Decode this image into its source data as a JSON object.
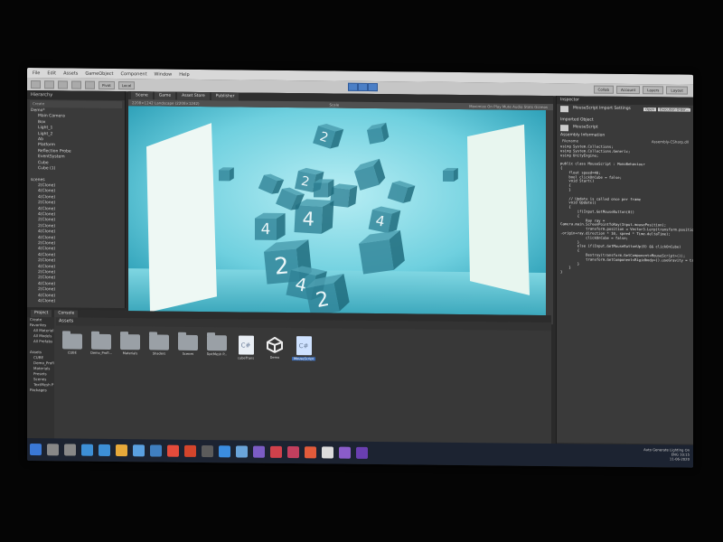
{
  "menubar": {
    "items": [
      "File",
      "Edit",
      "Assets",
      "GameObject",
      "Component",
      "Window",
      "Help"
    ]
  },
  "toolbar": {
    "pivot": "Pivot",
    "local": "Local",
    "right": [
      "Collab",
      "Account",
      "Layers",
      "Layout"
    ]
  },
  "hierarchy": {
    "tab": "Hierarchy",
    "create": "Create",
    "items": [
      "Demo*",
      "Main Camera",
      "Box",
      "Light_1",
      "Light_2",
      "Ab",
      "Platform",
      "Reflection Probe",
      "EventSystem",
      "Cube",
      "Cube (1)",
      "",
      "scenes",
      "2(Clone)",
      "4(Clone)",
      "4(Clone)",
      "2(Clone)",
      "4(Clone)",
      "4(Clone)",
      "2(Clone)",
      "2(Clone)",
      "4(Clone)",
      "4(Clone)",
      "2(Clone)",
      "4(Clone)",
      "4(Clone)",
      "2(Clone)",
      "4(Clone)",
      "2(Clone)",
      "2(Clone)",
      "4(Clone)",
      "2(Clone)",
      "4(Clone)",
      "4(Clone)"
    ]
  },
  "scene": {
    "tabs": [
      "Scene",
      "Game",
      "Asset Store",
      "Publisher"
    ],
    "aspect": "2208×1242 Landscape (2208×1242)",
    "scale": "Scale",
    "options": "Maximize On Play   Mute Audio   Stats   Gizmos",
    "cube_numbers": [
      "2",
      "2",
      "2",
      "4",
      "4",
      "4",
      "2",
      "4",
      "2",
      "2"
    ]
  },
  "project": {
    "tabs": [
      "Project",
      "Console"
    ],
    "create": "Create",
    "tree": [
      "Favorites",
      "All Material",
      "All Models",
      "All Prefabs",
      "",
      "Assets",
      "CUBE",
      "Demo_Profi",
      "Materials",
      "Presets",
      "Scenes",
      "TextMesh P",
      "Packages"
    ],
    "header": "Assets",
    "assets": [
      {
        "kind": "folder",
        "label": "CUBE"
      },
      {
        "kind": "folder",
        "label": "Demo_Profi..."
      },
      {
        "kind": "folder",
        "label": "Materials"
      },
      {
        "kind": "folder",
        "label": "Shaders"
      },
      {
        "kind": "folder",
        "label": "Scenes"
      },
      {
        "kind": "folder",
        "label": "TextMesh P..."
      },
      {
        "kind": "script",
        "label": "cubeTrans",
        "glyph": "C#"
      },
      {
        "kind": "unity",
        "label": "Demo"
      },
      {
        "kind": "script",
        "label": "MouseScript",
        "glyph": "C#",
        "selected": true
      }
    ],
    "footer": "Assets/MouseScript.cs"
  },
  "inspector": {
    "tabs": "Inspector",
    "title": "MouseScript Import Settings",
    "buttons": [
      "Open",
      "Execution Order..."
    ],
    "section1": "Imported Object",
    "script_name": "MouseScript",
    "section2": "Assembly Information",
    "filename_label": "Filename",
    "filename_value": "Assembly-CSharp.dll",
    "code": "using System.Collections;\nusing System.Collections.Generic;\nusing UnityEngine;\n\npublic class MouseScript : MonoBehaviour\n{\n    float speed=40;\n    bool clickOnCube = false;\n    void Start()\n    {\n    }\n\n    // Update is called once per frame\n    void Update()\n    {\n        if(Input.GetMouseButton(0))\n        {\n            Ray ray =\nCamera.main.ScreenPointToRay(Input.mousePosition);\n            transform.position = Vector3.Lerp(transform.position, ray\n.origin+ray.direction * 10, speed * Time.deltaTime);\n            clickOnCube = false;\n        }\n        else if(Input.GetMouseButtonUp(0) && clickOnCube)\n        {\n            Destroy(transform.GetComponent<MouseScript>());\n            transform.GetComponent<Rigidbody>().useGravity = true;\n        }\n    }\n}",
    "footer": "Asset Labels"
  },
  "taskbar": {
    "tray_line1": "Auto Generate Lighting On",
    "time": "10:15",
    "date": "11-06-2020",
    "lang": "ENG"
  }
}
